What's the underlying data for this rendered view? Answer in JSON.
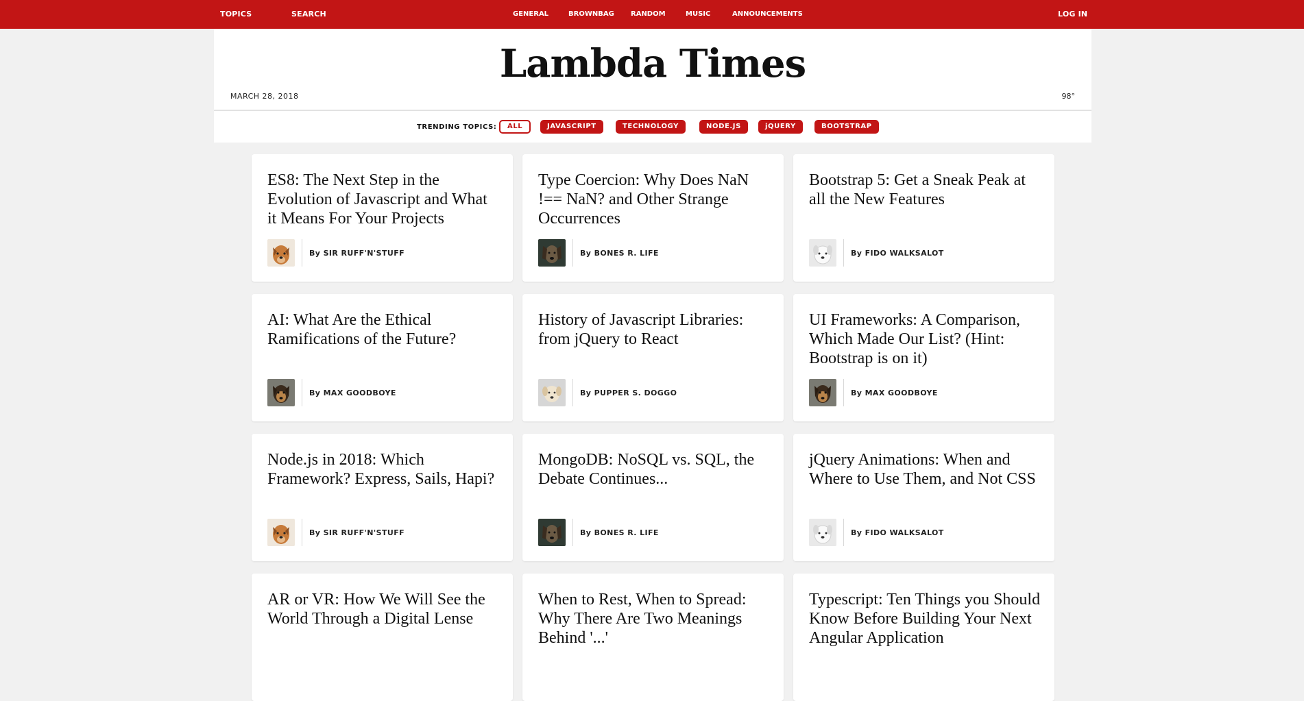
{
  "topbar": {
    "topics": "TOPICS",
    "search": "SEARCH",
    "nav": [
      "GENERAL",
      "BROWNBAG",
      "RANDOM",
      "MUSIC",
      "ANNOUNCEMENTS"
    ],
    "login": "LOG IN"
  },
  "header": {
    "title": "Lambda Times",
    "date": "MARCH 28, 2018",
    "temp": "98°"
  },
  "trending": {
    "label": "TRENDING TOPICS:",
    "tabs": [
      "ALL",
      "JAVASCRIPT",
      "TECHNOLOGY",
      "NODE.JS",
      "jQUERY",
      "BOOTSTRAP"
    ],
    "active": "ALL"
  },
  "cards": [
    {
      "title": "ES8: The Next Step in the Evolution of Javascript and What it Means For Your Projects",
      "author": "By SIR RUFF'N'STUFF",
      "avatar": "dog-tan"
    },
    {
      "title": "Type Coercion: Why Does NaN !== NaN? and Other Strange Occurrences",
      "author": "By BONES R. LIFE",
      "avatar": "dog-dark"
    },
    {
      "title": "Bootstrap 5: Get a Sneak Peak at all the New Features",
      "author": "By FIDO WALKSALOT",
      "avatar": "dog-white"
    },
    {
      "title": "AI: What Are the Ethical Ramifications of the Future?",
      "author": "By MAX GOODBOYE",
      "avatar": "dog-tricolor"
    },
    {
      "title": "History of Javascript Libraries: from jQuery to React",
      "author": "By PUPPER S. DOGGO",
      "avatar": "dog-cream"
    },
    {
      "title": "UI Frameworks: A Comparison, Which Made Our List? (Hint: Bootstrap is on it)",
      "author": "By MAX GOODBOYE",
      "avatar": "dog-tricolor"
    },
    {
      "title": "Node.js in 2018: Which Framework? Express, Sails, Hapi?",
      "author": "By SIR RUFF'N'STUFF",
      "avatar": "dog-tan"
    },
    {
      "title": "MongoDB: NoSQL vs. SQL, the Debate Continues...",
      "author": "By BONES R. LIFE",
      "avatar": "dog-dark"
    },
    {
      "title": "jQuery Animations: When and Where to Use Them, and Not CSS",
      "author": "By FIDO WALKSALOT",
      "avatar": "dog-white"
    },
    {
      "title": "AR or VR: How We Will See the World Through a Digital Lense",
      "author": "",
      "avatar": ""
    },
    {
      "title": "When to Rest, When to Spread: Why There Are Two Meanings Behind '...'",
      "author": "",
      "avatar": ""
    },
    {
      "title": "Typescript: Ten Things you Should Know Before Building Your Next Angular Application",
      "author": "",
      "avatar": ""
    }
  ],
  "colors": {
    "accent": "#c21515",
    "background": "#f1f1f1"
  }
}
